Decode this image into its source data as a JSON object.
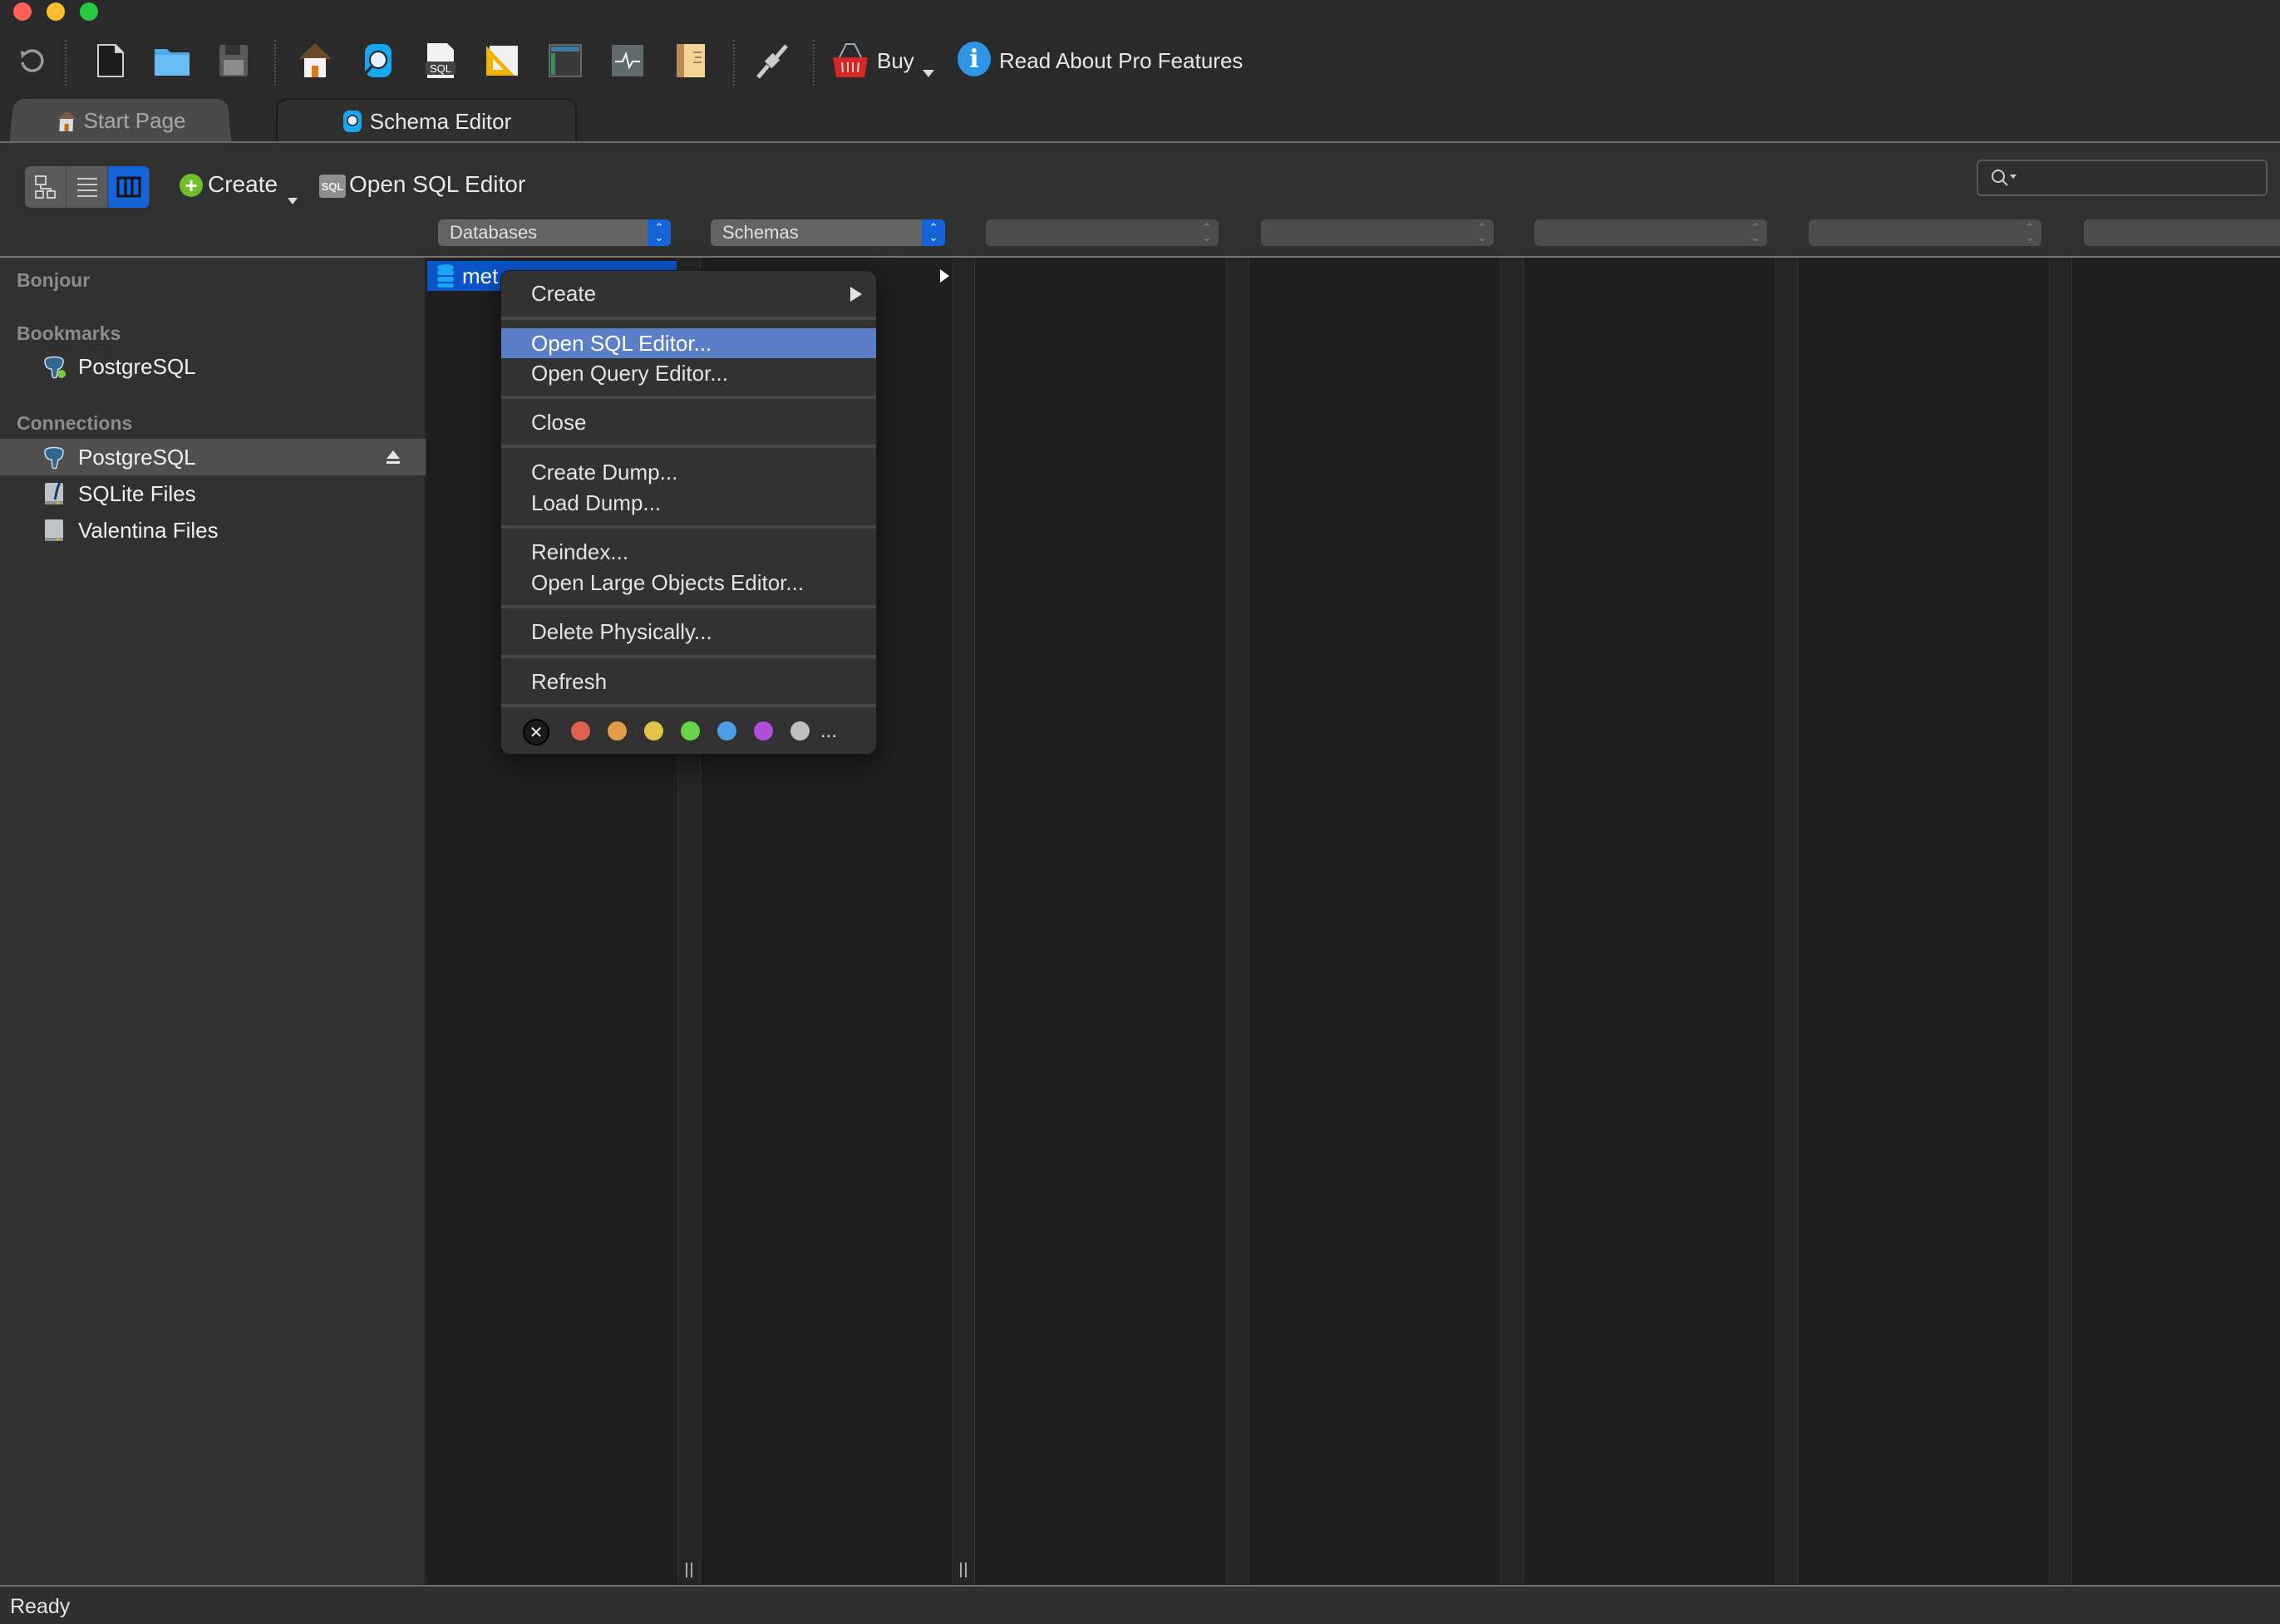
{
  "window": {
    "traffic_lights": [
      {
        "name": "close",
        "color": "#fe5f57"
      },
      {
        "name": "minimize",
        "color": "#febc2e"
      },
      {
        "name": "zoom",
        "color": "#28c840"
      }
    ]
  },
  "toolbar": {
    "icons": [
      "refresh-icon",
      "new-file-icon",
      "open-folder-icon",
      "save-icon",
      "home-icon",
      "schema-editor-icon",
      "sql-icon",
      "diagram-icon",
      "table-icon",
      "activity-icon",
      "book-icon",
      "connect-plug-icon"
    ],
    "buy_label": "Buy",
    "pro_label": "Read About Pro Features"
  },
  "tabs": [
    {
      "label": "Start Page",
      "active": false
    },
    {
      "label": "Schema Editor",
      "active": true
    }
  ],
  "toolbar2": {
    "view_modes": [
      "tree-view",
      "list-view",
      "column-view"
    ],
    "active_view": "column-view",
    "create_label": "Create",
    "open_sql_label": "Open SQL Editor",
    "search_placeholder": ""
  },
  "columns": {
    "popups": [
      {
        "label": "Databases"
      },
      {
        "label": "Schemas"
      },
      {
        "label": ""
      },
      {
        "label": ""
      },
      {
        "label": ""
      },
      {
        "label": ""
      },
      {
        "label": ""
      }
    ],
    "db_item": "met",
    "schema_item": ""
  },
  "sidebar": {
    "sections": [
      {
        "title": "Bonjour",
        "items": []
      },
      {
        "title": "Bookmarks",
        "items": [
          {
            "label": "PostgreSQL",
            "icon": "postgresql-icon",
            "connected": true
          }
        ]
      },
      {
        "title": "Connections",
        "items": [
          {
            "label": "PostgreSQL",
            "icon": "postgresql-icon",
            "selected": true,
            "ejectable": true
          },
          {
            "label": "SQLite Files",
            "icon": "sqlite-icon"
          },
          {
            "label": "Valentina Files",
            "icon": "valentina-icon"
          }
        ]
      }
    ]
  },
  "context_menu": {
    "items": [
      {
        "label": "Create",
        "submenu": true
      },
      {
        "label": "Open SQL Editor...",
        "highlighted": true
      },
      {
        "label": "Open Query Editor..."
      },
      {
        "label": "Close"
      },
      {
        "label": "Create Dump..."
      },
      {
        "label": "Load Dump..."
      },
      {
        "label": "Reindex..."
      },
      {
        "label": "Open Large Objects Editor..."
      },
      {
        "label": "Delete Physically..."
      },
      {
        "label": "Refresh"
      }
    ],
    "color_labels": [
      "none",
      "#e0614f",
      "#e39d4b",
      "#e0c547",
      "#6bd34a",
      "#4a9fe6",
      "#b04fd9",
      "#c0c0c0"
    ],
    "more_label": "..."
  },
  "status": {
    "text": "Ready"
  }
}
